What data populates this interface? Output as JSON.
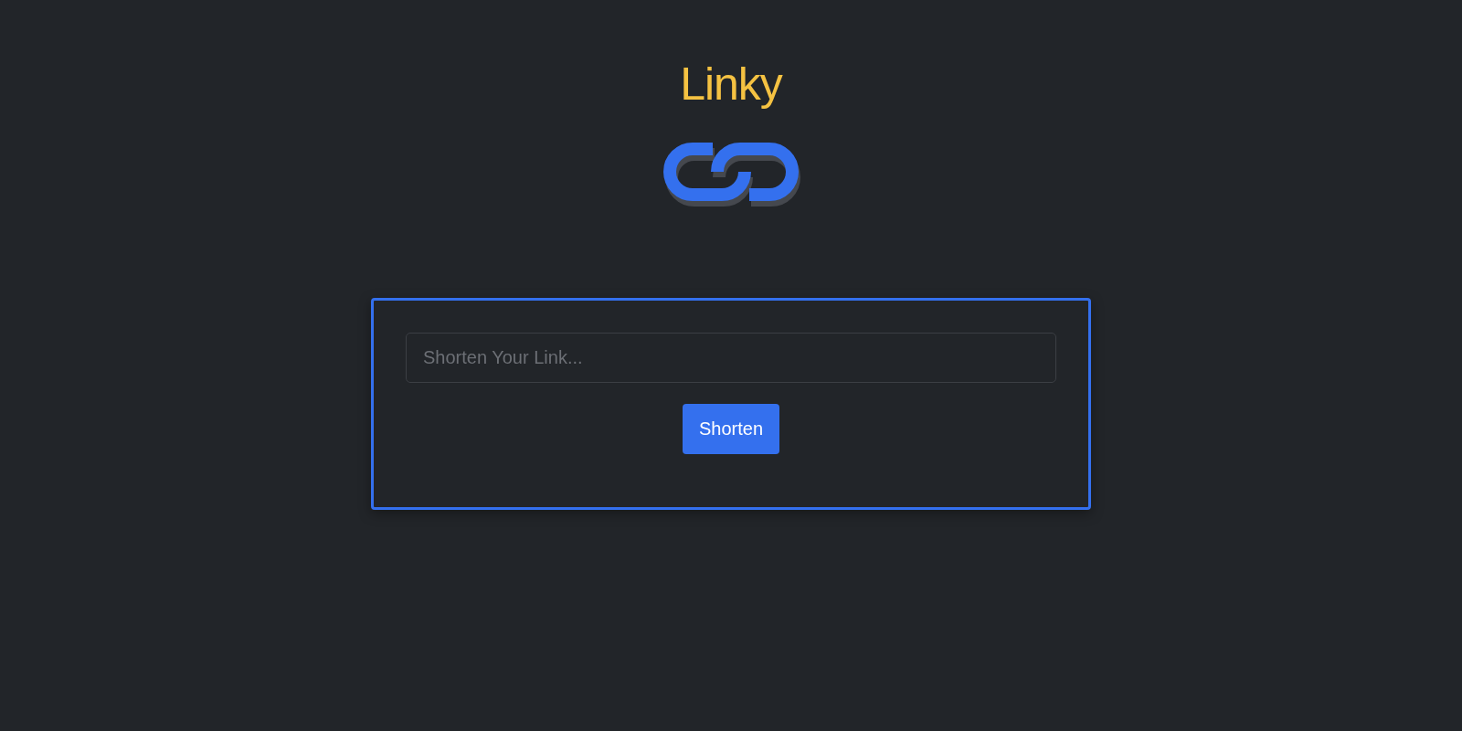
{
  "header": {
    "title": "Linky"
  },
  "form": {
    "placeholder": "Shorten Your Link...",
    "button": "Shorten"
  }
}
